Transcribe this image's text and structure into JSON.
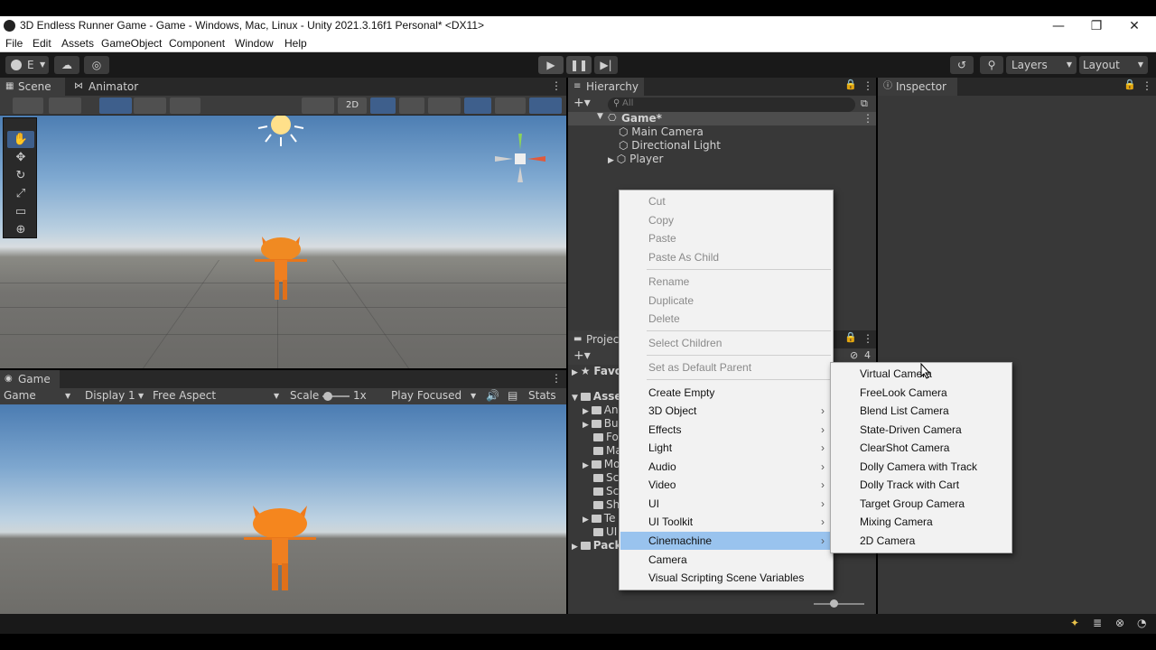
{
  "window": {
    "title": "3D Endless Runner Game - Game - Windows, Mac, Linux - Unity 2021.3.16f1 Personal* <DX11>",
    "minimize": "—",
    "maximize": "❐",
    "close": "✕"
  },
  "menubar": [
    "File",
    "Edit",
    "Assets",
    "GameObject",
    "Component",
    "Window",
    "Help"
  ],
  "toolbar": {
    "account_label": "E",
    "layers_label": "Layers",
    "layout_label": "Layout"
  },
  "scene": {
    "tabs": [
      "Scene",
      "Animator"
    ],
    "mode_2d": "2D"
  },
  "game": {
    "tab": "Game",
    "mode": "Game",
    "display": "Display 1",
    "aspect": "Free Aspect",
    "scale_label": "Scale",
    "scale_value": "1x",
    "play_focused": "Play Focused",
    "stats": "Stats"
  },
  "hierarchy": {
    "tab": "Hierarchy",
    "search_placeholder": "All",
    "scene_name": "Game*",
    "items": [
      "Main Camera",
      "Directional Light",
      "Player"
    ]
  },
  "project": {
    "tab": "Project",
    "favorites": "Favo",
    "assets": "Asse",
    "folders": [
      "An",
      "Bu",
      "Fo",
      "Ma",
      "Mo",
      "Sc",
      "Sc",
      "Sh",
      "Te",
      "UI"
    ],
    "packages": "Pack",
    "hidden_count": "4"
  },
  "inspector": {
    "tab": "Inspector"
  },
  "context_menu": {
    "items": [
      {
        "label": "Cut",
        "disabled": true
      },
      {
        "label": "Copy",
        "disabled": true
      },
      {
        "label": "Paste",
        "disabled": true
      },
      {
        "label": "Paste As Child",
        "disabled": true
      },
      {
        "label": "Rename",
        "disabled": true
      },
      {
        "label": "Duplicate",
        "disabled": true
      },
      {
        "label": "Delete",
        "disabled": true
      },
      {
        "label": "Select Children",
        "disabled": true
      },
      {
        "label": "Set as Default Parent",
        "disabled": true
      },
      {
        "label": "Create Empty",
        "disabled": false
      },
      {
        "label": "3D Object",
        "disabled": false,
        "submenu": true
      },
      {
        "label": "Effects",
        "disabled": false,
        "submenu": true
      },
      {
        "label": "Light",
        "disabled": false,
        "submenu": true
      },
      {
        "label": "Audio",
        "disabled": false,
        "submenu": true
      },
      {
        "label": "Video",
        "disabled": false,
        "submenu": true
      },
      {
        "label": "UI",
        "disabled": false,
        "submenu": true
      },
      {
        "label": "UI Toolkit",
        "disabled": false,
        "submenu": true
      },
      {
        "label": "Cinemachine",
        "disabled": false,
        "submenu": true,
        "highlighted": true
      },
      {
        "label": "Camera",
        "disabled": false
      },
      {
        "label": "Visual Scripting Scene Variables",
        "disabled": false
      }
    ]
  },
  "cinemachine_submenu": {
    "items": [
      "Virtual Camera",
      "FreeLook Camera",
      "Blend List Camera",
      "State-Driven Camera",
      "ClearShot Camera",
      "Dolly Camera with Track",
      "Dolly Track with Cart",
      "Target Group Camera",
      "Mixing Camera",
      "2D Camera"
    ]
  }
}
